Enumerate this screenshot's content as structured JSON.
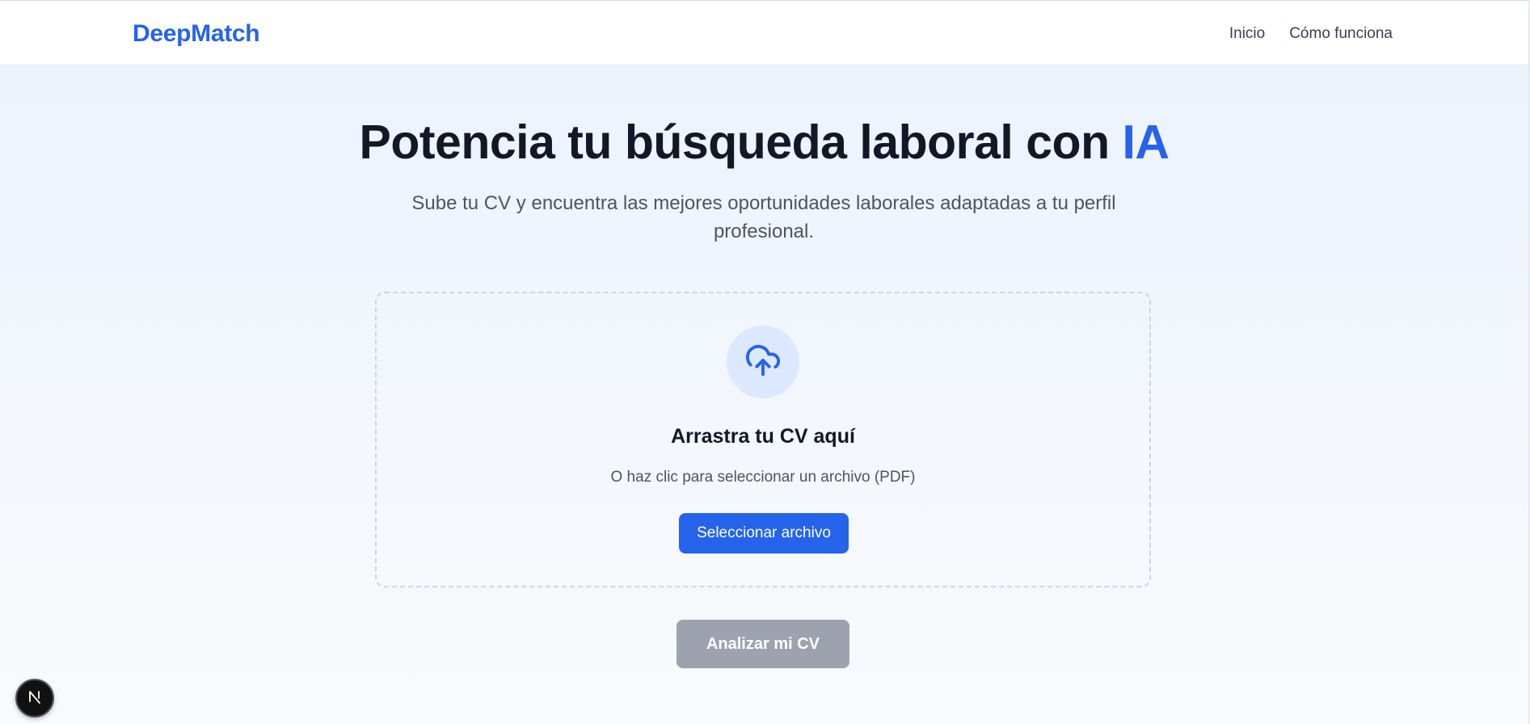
{
  "header": {
    "brand": "DeepMatch",
    "nav": [
      "Inicio",
      "Cómo funciona"
    ]
  },
  "hero": {
    "title": "Potencia tu búsqueda laboral con ",
    "title_accent": "IA",
    "subtitle": "Sube tu CV y encuentra las mejores oportunidades laborales adaptadas a tu perfil profesional."
  },
  "upload": {
    "icon": "cloud-upload-icon",
    "title": "Arrastra tu CV aquí",
    "hint": "O haz clic para seleccionar un archivo (PDF)",
    "button_label": "Seleccionar archivo"
  },
  "analyze_button": "Analizar mi CV",
  "dev_badge": {
    "icon": "nextjs-logo-icon",
    "letter": "N"
  },
  "colors": {
    "brand": "#2563eb",
    "disabled_button": "#9ca3af",
    "icon_circle": "#dbe8fd"
  }
}
